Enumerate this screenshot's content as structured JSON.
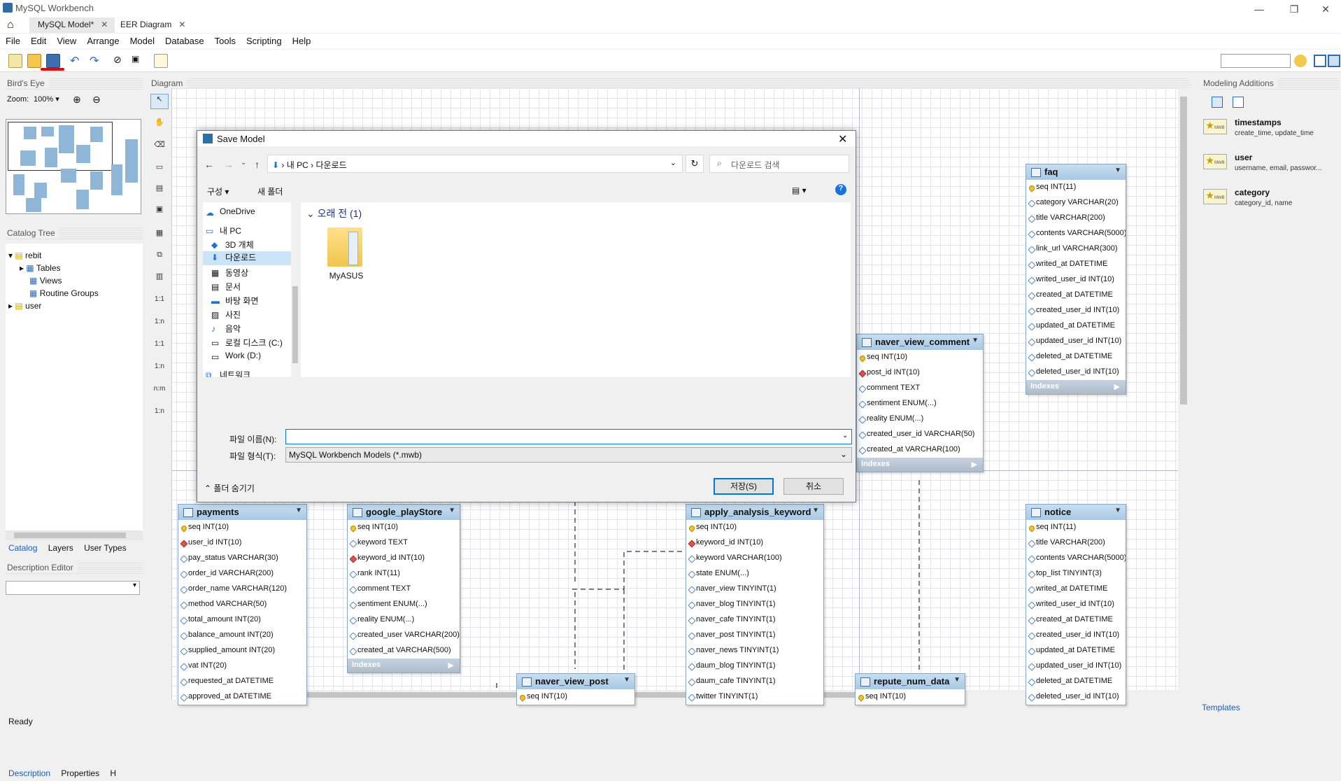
{
  "app": {
    "title": "MySQL Workbench",
    "tabs": [
      {
        "label": "MySQL Model*"
      },
      {
        "label": "EER Diagram"
      }
    ]
  },
  "menu": [
    "File",
    "Edit",
    "View",
    "Arrange",
    "Model",
    "Database",
    "Tools",
    "Scripting",
    "Help"
  ],
  "left": {
    "birds_eye": "Bird's Eye",
    "zoom_label": "Zoom:",
    "zoom_value": "100%",
    "catalog_tree": "Catalog Tree",
    "tree": {
      "schema1": "rebit",
      "tables": "Tables",
      "views": "Views",
      "routines": "Routine Groups",
      "schema2": "user"
    },
    "bottom_tabs": [
      "Catalog",
      "Layers",
      "User Types"
    ],
    "desc_editor": "Description Editor",
    "footer_tabs": [
      "Description",
      "Properties",
      "H"
    ]
  },
  "diagram_label": "Diagram",
  "rel_labels": [
    "1:1",
    "1:n",
    "1:1",
    "1:n",
    "n:m",
    "1:n"
  ],
  "entities": {
    "faq": {
      "name": "faq",
      "rows": [
        "seq INT(11)",
        "category VARCHAR(20)",
        "title VARCHAR(200)",
        "contents VARCHAR(5000)",
        "link_url VARCHAR(300)",
        "writed_at DATETIME",
        "writed_user_id INT(10)",
        "created_at DATETIME",
        "created_user_id INT(10)",
        "updated_at DATETIME",
        "updated_user_id INT(10)",
        "deleted_at DATETIME",
        "deleted_user_id INT(10)"
      ],
      "idx": "Indexes"
    },
    "naver_view_comment": {
      "name": "naver_view_comment",
      "rows": [
        "seq INT(10)",
        "post_id INT(10)",
        "comment TEXT",
        "sentiment ENUM(...)",
        "reality ENUM(...)",
        "created_user_id VARCHAR(50)",
        "created_at VARCHAR(100)"
      ],
      "idx": "Indexes"
    },
    "payments": {
      "name": "payments",
      "rows": [
        "seq INT(10)",
        "user_id INT(10)",
        "pay_status VARCHAR(30)",
        "order_id VARCHAR(200)",
        "order_name VARCHAR(120)",
        "method VARCHAR(50)",
        "total_amount INT(20)",
        "balance_amount INT(20)",
        "supplied_amount INT(20)",
        "vat INT(20)",
        "requested_at DATETIME",
        "approved_at DATETIME"
      ]
    },
    "google_playStore": {
      "name": "google_playStore",
      "rows": [
        "seq INT(10)",
        "keyword TEXT",
        "keyword_id INT(10)",
        "rank INT(11)",
        "comment TEXT",
        "sentiment ENUM(...)",
        "reality ENUM(...)",
        "created_user VARCHAR(200)",
        "created_at VARCHAR(500)"
      ],
      "idx": "Indexes"
    },
    "apply_analysis_keyword": {
      "name": "apply_analysis_keyword",
      "rows": [
        "seq INT(10)",
        "keyword_id INT(10)",
        "keyword VARCHAR(100)",
        "state ENUM(...)",
        "naver_view TINYINT(1)",
        "naver_blog TINYINT(1)",
        "naver_cafe TINYINT(1)",
        "naver_post TINYINT(1)",
        "naver_news TINYINT(1)",
        "daum_blog TINYINT(1)",
        "daum_cafe TINYINT(1)",
        "twitter TINYINT(1)"
      ]
    },
    "notice": {
      "name": "notice",
      "rows": [
        "seq INT(11)",
        "title VARCHAR(200)",
        "contents VARCHAR(5000)",
        "top_list TINYINT(3)",
        "writed_at DATETIME",
        "writed_user_id INT(10)",
        "created_at DATETIME",
        "created_user_id INT(10)",
        "updated_at DATETIME",
        "updated_user_id INT(10)",
        "deleted_at DATETIME",
        "deleted_user_id INT(10)"
      ]
    },
    "naver_view_post": {
      "name": "naver_view_post",
      "rows": [
        "seq INT(10)"
      ]
    },
    "repute_num_data": {
      "name": "repute_num_data",
      "rows": [
        "seq INT(10)"
      ]
    }
  },
  "right": {
    "title": "Modeling Additions",
    "templates_tab": "Templates",
    "templates": [
      {
        "name": "timestamps",
        "desc": "create_time, update_time"
      },
      {
        "name": "user",
        "desc": "username, email, passwor..."
      },
      {
        "name": "category",
        "desc": "category_id, name"
      }
    ],
    "icon_label": "MWB"
  },
  "status": "Ready",
  "dialog": {
    "title": "Save Model",
    "path": [
      "내 PC",
      "다운로드"
    ],
    "search_placeholder": "다운로드 검색",
    "organize": "구성 ▾",
    "new_folder": "새 폴더",
    "nav": [
      {
        "label": "OneDrive",
        "icon": "cloud-icon"
      },
      {
        "label": "내 PC",
        "icon": "pc-icon"
      },
      {
        "label": "3D 개체",
        "icon": "cube-icon"
      },
      {
        "label": "다운로드",
        "icon": "download-icon"
      },
      {
        "label": "동영상",
        "icon": "video-icon"
      },
      {
        "label": "문서",
        "icon": "document-icon"
      },
      {
        "label": "바탕 화면",
        "icon": "desktop-icon"
      },
      {
        "label": "사진",
        "icon": "picture-icon"
      },
      {
        "label": "음악",
        "icon": "music-icon"
      },
      {
        "label": "로컬 디스크 (C:)",
        "icon": "disk-icon"
      },
      {
        "label": "Work (D:)",
        "icon": "disk-icon"
      },
      {
        "label": "네트워크",
        "icon": "network-icon"
      }
    ],
    "group": "오래 전 (1)",
    "folder": "MyASUS",
    "filename_label": "파일 이름(N):",
    "filename_value": "",
    "filetype_label": "파일 형식(T):",
    "filetype_value": "MySQL Workbench Models (*.mwb)",
    "hide_folders": "폴더 숨기기",
    "save": "저장(S)",
    "cancel": "취소"
  },
  "colors": {
    "accent": "#0078d7",
    "entity_header": "#a8c8e4",
    "grid": "#e4e4ec"
  }
}
